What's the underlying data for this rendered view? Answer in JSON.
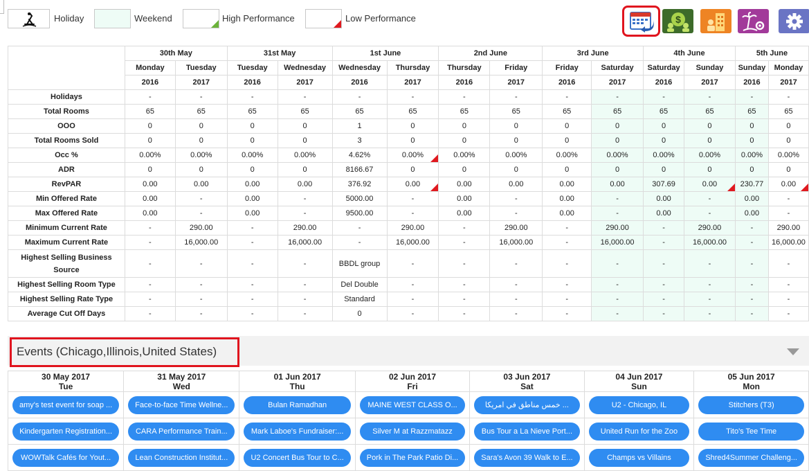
{
  "legend": {
    "holiday": "Holiday",
    "weekend": "Weekend",
    "high": "High Performance",
    "low": "Low Performance"
  },
  "colors": {
    "weekend_bg": "#eefcf6",
    "high_marker": "#6bb33a",
    "low_marker": "#e0191f",
    "pill": "#2f8cf1",
    "selection_outline": "#e0141e"
  },
  "toolbar": {
    "icons": [
      "calendar-compare-icon",
      "revenue-users-icon",
      "hotel-building-icon",
      "holiday-settings-icon",
      "settings-gear-icon"
    ],
    "selected": "calendar-compare-icon"
  },
  "report": {
    "dates": [
      "30th May",
      "31st May",
      "1st June",
      "2nd June",
      "3rd June",
      "4th June",
      "5th June"
    ],
    "days": [
      "Monday",
      "Tuesday",
      "Tuesday",
      "Wednesday",
      "Wednesday",
      "Thursday",
      "Thursday",
      "Friday",
      "Friday",
      "Saturday",
      "Saturday",
      "Sunday",
      "Sunday",
      "Monday"
    ],
    "years": [
      "2016",
      "2017",
      "2016",
      "2017",
      "2016",
      "2017",
      "2016",
      "2017",
      "2016",
      "2017",
      "2016",
      "2017",
      "2016",
      "2017"
    ],
    "weekend_cols": [
      9,
      10,
      11,
      12
    ],
    "rows": [
      {
        "label": "Holidays",
        "values": [
          "-",
          "-",
          "-",
          "-",
          "-",
          "-",
          "-",
          "-",
          "-",
          "-",
          "-",
          "-",
          "-",
          "-"
        ],
        "low": []
      },
      {
        "label": "Total Rooms",
        "values": [
          "65",
          "65",
          "65",
          "65",
          "65",
          "65",
          "65",
          "65",
          "65",
          "65",
          "65",
          "65",
          "65",
          "65"
        ],
        "low": []
      },
      {
        "label": "OOO",
        "values": [
          "0",
          "0",
          "0",
          "0",
          "1",
          "0",
          "0",
          "0",
          "0",
          "0",
          "0",
          "0",
          "0",
          "0"
        ],
        "low": []
      },
      {
        "label": "Total Rooms Sold",
        "values": [
          "0",
          "0",
          "0",
          "0",
          "3",
          "0",
          "0",
          "0",
          "0",
          "0",
          "0",
          "0",
          "0",
          "0"
        ],
        "low": []
      },
      {
        "label": "Occ %",
        "values": [
          "0.00%",
          "0.00%",
          "0.00%",
          "0.00%",
          "4.62%",
          "0.00%",
          "0.00%",
          "0.00%",
          "0.00%",
          "0.00%",
          "0.00%",
          "0.00%",
          "0.00%",
          "0.00%"
        ],
        "low": [
          5
        ]
      },
      {
        "label": "ADR",
        "values": [
          "0",
          "0",
          "0",
          "0",
          "8166.67",
          "0",
          "0",
          "0",
          "0",
          "0",
          "0",
          "0",
          "0",
          "0"
        ],
        "low": []
      },
      {
        "label": "RevPAR",
        "values": [
          "0.00",
          "0.00",
          "0.00",
          "0.00",
          "376.92",
          "0.00",
          "0.00",
          "0.00",
          "0.00",
          "0.00",
          "307.69",
          "0.00",
          "230.77",
          "0.00"
        ],
        "low": [
          5,
          11,
          13
        ]
      },
      {
        "label": "Min Offered Rate",
        "values": [
          "0.00",
          "-",
          "0.00",
          "-",
          "5000.00",
          "-",
          "0.00",
          "-",
          "0.00",
          "-",
          "0.00",
          "-",
          "0.00",
          "-"
        ],
        "low": []
      },
      {
        "label": "Max Offered Rate",
        "values": [
          "0.00",
          "-",
          "0.00",
          "-",
          "9500.00",
          "-",
          "0.00",
          "-",
          "0.00",
          "-",
          "0.00",
          "-",
          "0.00",
          "-"
        ],
        "low": []
      },
      {
        "label": "Minimum Current Rate",
        "values": [
          "-",
          "290.00",
          "-",
          "290.00",
          "-",
          "290.00",
          "-",
          "290.00",
          "-",
          "290.00",
          "-",
          "290.00",
          "-",
          "290.00"
        ],
        "low": []
      },
      {
        "label": "Maximum Current Rate",
        "values": [
          "-",
          "16,000.00",
          "-",
          "16,000.00",
          "-",
          "16,000.00",
          "-",
          "16,000.00",
          "-",
          "16,000.00",
          "-",
          "16,000.00",
          "-",
          "16,000.00"
        ],
        "low": []
      },
      {
        "label": "Highest Selling Business Source",
        "values": [
          "-",
          "-",
          "-",
          "-",
          "BBDL group",
          "-",
          "-",
          "-",
          "-",
          "-",
          "-",
          "-",
          "-",
          "-"
        ],
        "low": [],
        "tall": true
      },
      {
        "label": "Highest Selling Room Type",
        "values": [
          "-",
          "-",
          "-",
          "-",
          "Del Double",
          "-",
          "-",
          "-",
          "-",
          "-",
          "-",
          "-",
          "-",
          "-"
        ],
        "low": []
      },
      {
        "label": "Highest Selling Rate Type",
        "values": [
          "-",
          "-",
          "-",
          "-",
          "Standard",
          "-",
          "-",
          "-",
          "-",
          "-",
          "-",
          "-",
          "-",
          "-"
        ],
        "low": []
      },
      {
        "label": "Average Cut Off Days",
        "values": [
          "-",
          "-",
          "-",
          "-",
          "0",
          "-",
          "-",
          "-",
          "-",
          "-",
          "-",
          "-",
          "-",
          "-"
        ],
        "low": []
      }
    ]
  },
  "events": {
    "title": "Events (Chicago,Illinois,United States)",
    "days": [
      {
        "date": "30 May 2017",
        "weekday": "Tue"
      },
      {
        "date": "31 May 2017",
        "weekday": "Wed"
      },
      {
        "date": "01 Jun 2017",
        "weekday": "Thu"
      },
      {
        "date": "02 Jun 2017",
        "weekday": "Fri"
      },
      {
        "date": "03 Jun 2017",
        "weekday": "Sat"
      },
      {
        "date": "04 Jun 2017",
        "weekday": "Sun"
      },
      {
        "date": "05 Jun 2017",
        "weekday": "Mon"
      }
    ],
    "rows": [
      [
        "amy's test event for soap ...",
        "Face-to-face Time Wellne...",
        "Bulan Ramadhan",
        "MAINE WEST CLASS O...",
        "خمس مناطق في امريكا ...",
        "U2 - Chicago, IL",
        "Stitchers (T3)"
      ],
      [
        "Kindergarten Registration...",
        "CARA Performance Train...",
        "Mark Laboe's Fundraiser:...",
        "Silver M at Razzmatazz",
        "Bus Tour a La Nieve Port...",
        "United Run for the Zoo",
        "Tito's Tee Time"
      ],
      [
        "WOWTalk Cafés for Yout...",
        "Lean Construction Institut...",
        "U2 Concert Bus Tour to C...",
        "Pork in The Park Patio Di...",
        "Sara's Avon 39 Walk to E...",
        "Champs vs Villains",
        "Shred4Summer Challeng..."
      ]
    ]
  }
}
